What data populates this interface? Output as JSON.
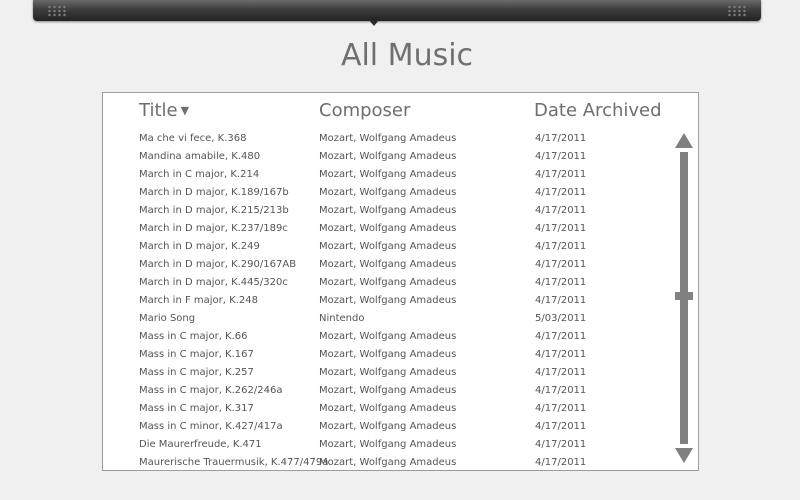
{
  "page": {
    "title": "All Music"
  },
  "table": {
    "headers": {
      "title": "Title",
      "composer": "Composer",
      "date": "Date Archived"
    },
    "sort_indicator": "▼",
    "rows": [
      {
        "title": "Ma che vi fece, K.368",
        "composer": "Mozart, Wolfgang Amadeus",
        "date": "4/17/2011"
      },
      {
        "title": "Mandina amabile, K.480",
        "composer": "Mozart, Wolfgang Amadeus",
        "date": "4/17/2011"
      },
      {
        "title": "March in C major, K.214",
        "composer": "Mozart, Wolfgang Amadeus",
        "date": "4/17/2011"
      },
      {
        "title": "March in D major, K.189/167b",
        "composer": "Mozart, Wolfgang Amadeus",
        "date": "4/17/2011"
      },
      {
        "title": "March in D major, K.215/213b",
        "composer": "Mozart, Wolfgang Amadeus",
        "date": "4/17/2011"
      },
      {
        "title": "March in D major, K.237/189c",
        "composer": "Mozart, Wolfgang Amadeus",
        "date": "4/17/2011"
      },
      {
        "title": "March in D major, K.249",
        "composer": "Mozart, Wolfgang Amadeus",
        "date": "4/17/2011"
      },
      {
        "title": "March in D major, K.290/167AB",
        "composer": "Mozart, Wolfgang Amadeus",
        "date": "4/17/2011"
      },
      {
        "title": "March in D major, K.445/320c",
        "composer": "Mozart, Wolfgang Amadeus",
        "date": "4/17/2011"
      },
      {
        "title": "March in F major, K.248",
        "composer": "Mozart, Wolfgang Amadeus",
        "date": "4/17/2011"
      },
      {
        "title": "Mario Song",
        "composer": "Nintendo",
        "date": "5/03/2011"
      },
      {
        "title": "Mass in C major, K.66",
        "composer": "Mozart, Wolfgang Amadeus",
        "date": "4/17/2011"
      },
      {
        "title": "Mass in C major, K.167",
        "composer": "Mozart, Wolfgang Amadeus",
        "date": "4/17/2011"
      },
      {
        "title": "Mass in C major, K.257",
        "composer": "Mozart, Wolfgang Amadeus",
        "date": "4/17/2011"
      },
      {
        "title": "Mass in C major, K.262/246a",
        "composer": "Mozart, Wolfgang Amadeus",
        "date": "4/17/2011"
      },
      {
        "title": "Mass in C major, K.317",
        "composer": "Mozart, Wolfgang Amadeus",
        "date": "4/17/2011"
      },
      {
        "title": "Mass in C minor, K.427/417a",
        "composer": "Mozart, Wolfgang Amadeus",
        "date": "4/17/2011"
      },
      {
        "title": "Die Maurerfreude, K.471",
        "composer": "Mozart, Wolfgang Amadeus",
        "date": "4/17/2011"
      },
      {
        "title": "Maurerische Trauermusik, K.477/479a",
        "composer": "Mozart, Wolfgang Amadeus",
        "date": "4/17/2011"
      }
    ]
  },
  "icons": {
    "top_bar_grips": "grip-dots-icon",
    "sort": "sort-descending-icon",
    "scroll_up": "arrow-up-icon",
    "scroll_down": "arrow-down-icon"
  },
  "colors": {
    "background": "#f0f0f0",
    "topbar_dark": "#232323",
    "text": "#555555",
    "header_text": "#6e6e6e",
    "scrollbar": "#808080"
  }
}
